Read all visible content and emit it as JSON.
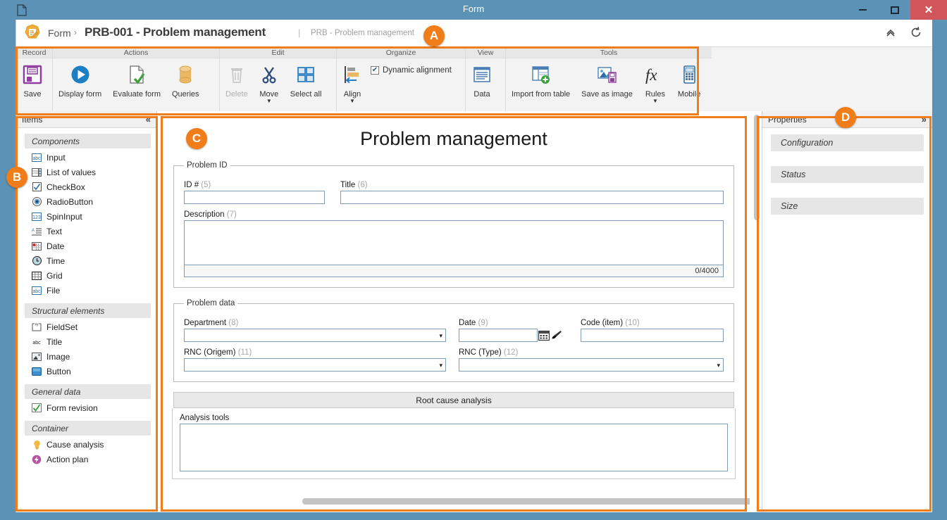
{
  "window": {
    "title": "Form",
    "doc_icon": "document-icon",
    "minimize_label": "Minimize",
    "maximize_label": "Maximize",
    "close_label": "Close"
  },
  "breadcrumb": {
    "logo_icon": "form-designer-logo-icon",
    "root": "Form",
    "separator": "›",
    "current": "PRB-001 - Problem management",
    "pipe": "|",
    "subtitle": "PRB - Problem management",
    "collapse_icon": "chevron-up-icon",
    "refresh_icon": "refresh-icon"
  },
  "ribbon": {
    "groups": [
      {
        "title": "Record",
        "buttons": [
          {
            "label": "Save",
            "icon": "save-floppy-icon",
            "disabled": false,
            "caret": false
          }
        ]
      },
      {
        "title": "Actions",
        "buttons": [
          {
            "label": "Display form",
            "icon": "play-circle-icon",
            "disabled": false,
            "caret": false
          },
          {
            "label": "Evaluate form",
            "icon": "document-check-icon",
            "disabled": false,
            "caret": false
          },
          {
            "label": "Queries",
            "icon": "database-cylinder-icon",
            "disabled": false,
            "caret": false
          }
        ]
      },
      {
        "title": "Edit",
        "buttons": [
          {
            "label": "Delete",
            "icon": "trash-icon",
            "disabled": true,
            "caret": false
          },
          {
            "label": "Move",
            "icon": "scissors-icon",
            "disabled": false,
            "caret": true
          },
          {
            "label": "Select all",
            "icon": "select-all-grid-icon",
            "disabled": false,
            "caret": false
          }
        ]
      },
      {
        "title": "Organize",
        "buttons": [
          {
            "label": "Align",
            "icon": "align-left-icon",
            "disabled": false,
            "caret": true
          }
        ],
        "checkbox": {
          "label": "Dynamic alignment",
          "checked": true,
          "mark": "✔"
        }
      },
      {
        "title": "View",
        "buttons": [
          {
            "label": "Data",
            "icon": "data-lines-icon",
            "disabled": false,
            "caret": false
          }
        ]
      },
      {
        "title": "Tools",
        "buttons": [
          {
            "label": "Import from table",
            "icon": "import-table-icon",
            "disabled": false,
            "caret": false
          },
          {
            "label": "Save as image",
            "icon": "save-as-image-icon",
            "disabled": false,
            "caret": false
          },
          {
            "label": "Rules",
            "icon": "fx-function-icon",
            "disabled": false,
            "caret": true
          },
          {
            "label": "Mobile",
            "icon": "mobile-device-icon",
            "disabled": false,
            "caret": false
          }
        ]
      }
    ]
  },
  "items_panel": {
    "title": "Items",
    "collapse_icon": "chevrons-left-icon",
    "sections": [
      {
        "title": "Components",
        "items": [
          {
            "label": "Input",
            "icon": "abc-input-icon"
          },
          {
            "label": "List of values",
            "icon": "list-of-values-icon"
          },
          {
            "label": "CheckBox",
            "icon": "checkbox-icon"
          },
          {
            "label": "RadioButton",
            "icon": "radiobutton-icon"
          },
          {
            "label": "SpinInput",
            "icon": "123-spin-icon"
          },
          {
            "label": "Text",
            "icon": "text-lines-icon"
          },
          {
            "label": "Date",
            "icon": "date-calendar-icon"
          },
          {
            "label": "Time",
            "icon": "clock-icon"
          },
          {
            "label": "Grid",
            "icon": "grid-table-icon"
          },
          {
            "label": "File",
            "icon": "abc-file-icon"
          }
        ]
      },
      {
        "title": "Structural elements",
        "items": [
          {
            "label": "FieldSet",
            "icon": "fieldset-icon"
          },
          {
            "label": "Title",
            "icon": "abc-title-icon"
          },
          {
            "label": "Image",
            "icon": "image-icon"
          },
          {
            "label": "Button",
            "icon": "button-icon"
          }
        ]
      },
      {
        "title": "General data",
        "items": [
          {
            "label": "Form revision",
            "icon": "form-revision-check-icon"
          }
        ]
      },
      {
        "title": "Container",
        "items": [
          {
            "label": "Cause analysis",
            "icon": "lightbulb-icon"
          },
          {
            "label": "Action plan",
            "icon": "action-plan-icon"
          }
        ]
      }
    ]
  },
  "form": {
    "title": "Problem management",
    "fieldsets": [
      {
        "legend": "Problem ID",
        "fields": [
          {
            "label": "ID #",
            "num": "(5)",
            "type": "input"
          },
          {
            "label": "Title",
            "num": "(6)",
            "type": "input"
          },
          {
            "label": "Description",
            "num": "(7)",
            "type": "textarea",
            "counter": "0/4000"
          }
        ]
      },
      {
        "legend": "Problem data",
        "fields": [
          {
            "label": "Department",
            "num": "(8)",
            "type": "select"
          },
          {
            "label": "Date",
            "num": "(9)",
            "type": "date",
            "calendar_icon": "calendar-icon",
            "clear_icon": "brush-clear-icon"
          },
          {
            "label": "Code (item)",
            "num": "(10)",
            "type": "input"
          },
          {
            "label": "RNC (Origem)",
            "num": "(11)",
            "type": "select"
          },
          {
            "label": "RNC (Type)",
            "num": "(12)",
            "type": "select"
          }
        ]
      }
    ],
    "section": {
      "title": "Root cause analysis",
      "field_label": "Analysis tools"
    },
    "select_arrow": "▾"
  },
  "properties_panel": {
    "title": "Properties",
    "expand_icon": "chevrons-right-icon",
    "sections": [
      {
        "label": "Configuration"
      },
      {
        "label": "Status"
      },
      {
        "label": "Size"
      }
    ]
  },
  "annotations": {
    "badges": [
      {
        "letter": "A",
        "target": "ribbon-toolbar"
      },
      {
        "letter": "B",
        "target": "items-panel"
      },
      {
        "letter": "C",
        "target": "form-canvas"
      },
      {
        "letter": "D",
        "target": "properties-panel"
      }
    ],
    "accent_color": "#f07d1a"
  },
  "colors": {
    "titlebar": "#5b92b5",
    "close_button": "#d0565b",
    "accent_orange": "#f07d1a",
    "ribbon_bg": "#f3f3f3",
    "panel_section": "#e6e6e6",
    "field_border": "#7f9db9"
  }
}
